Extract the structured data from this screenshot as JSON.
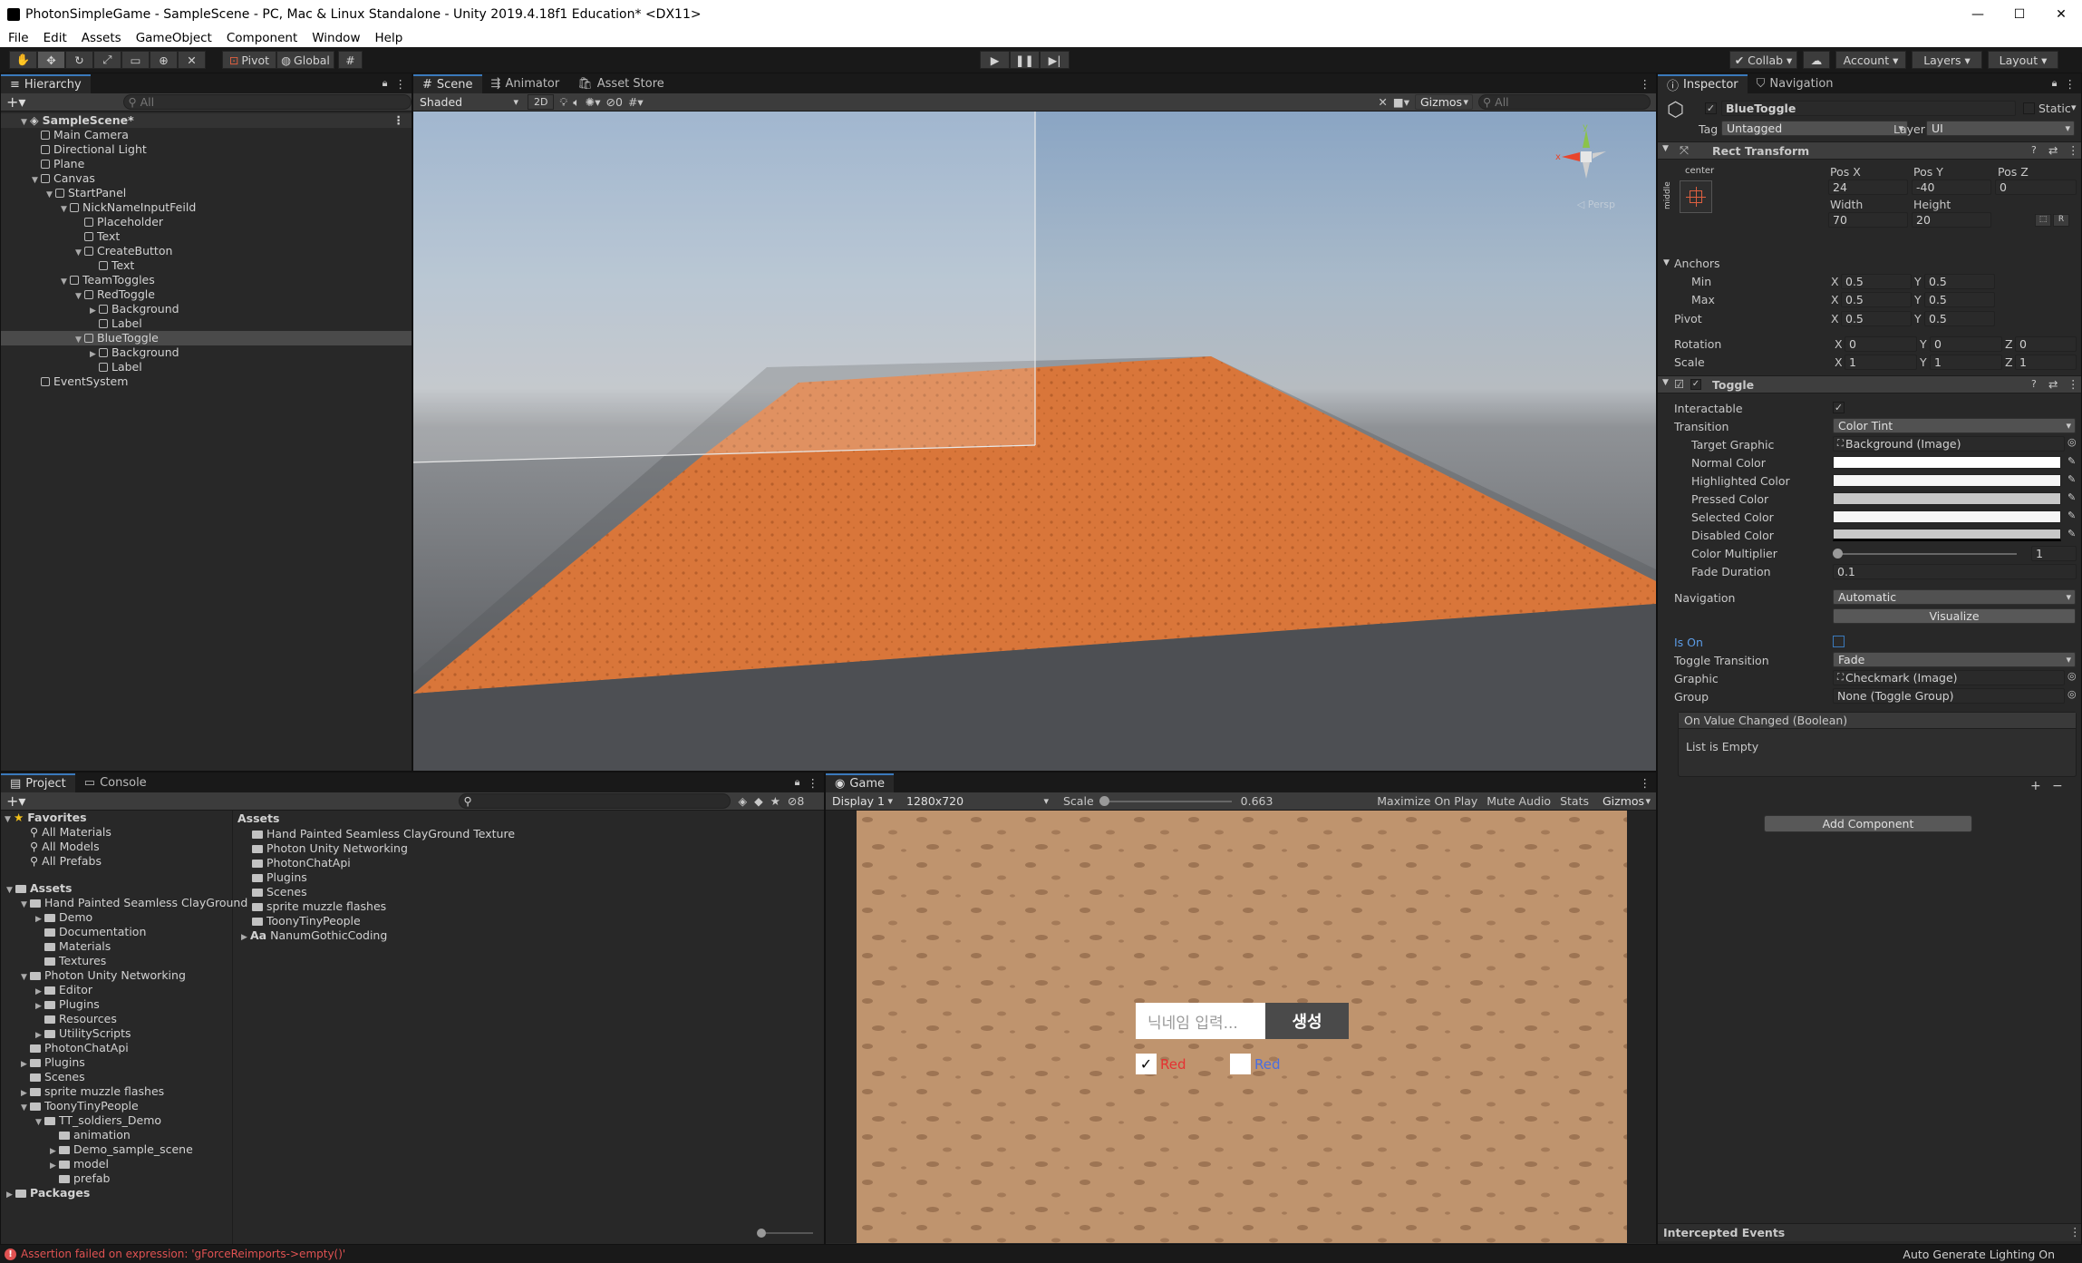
{
  "window": {
    "title": "PhotonSimpleGame - SampleScene - PC, Mac & Linux Standalone - Unity 2019.4.18f1 Education* <DX11>",
    "min": "—",
    "max": "☐",
    "close": "✕"
  },
  "menu": [
    "File",
    "Edit",
    "Assets",
    "GameObject",
    "Component",
    "Window",
    "Help"
  ],
  "toolbar": {
    "pivot": "Pivot",
    "global": "Global",
    "collab": "Collab",
    "account": "Account",
    "layers": "Layers",
    "layout": "Layout"
  },
  "hierarchy": {
    "tab": "Hierarchy",
    "search": "All",
    "scene": "SampleScene*",
    "items": [
      {
        "label": "Main Camera",
        "indent": 1,
        "arrow": ""
      },
      {
        "label": "Directional Light",
        "indent": 1,
        "arrow": ""
      },
      {
        "label": "Plane",
        "indent": 1,
        "arrow": ""
      },
      {
        "label": "Canvas",
        "indent": 1,
        "arrow": "▼"
      },
      {
        "label": "StartPanel",
        "indent": 2,
        "arrow": "▼"
      },
      {
        "label": "NickNameInputFeild",
        "indent": 3,
        "arrow": "▼"
      },
      {
        "label": "Placeholder",
        "indent": 4,
        "arrow": ""
      },
      {
        "label": "Text",
        "indent": 4,
        "arrow": ""
      },
      {
        "label": "CreateButton",
        "indent": 4,
        "arrow": "▼"
      },
      {
        "label": "Text",
        "indent": 5,
        "arrow": ""
      },
      {
        "label": "TeamToggles",
        "indent": 3,
        "arrow": "▼"
      },
      {
        "label": "RedToggle",
        "indent": 4,
        "arrow": "▼"
      },
      {
        "label": "Background",
        "indent": 5,
        "arrow": "▶"
      },
      {
        "label": "Label",
        "indent": 5,
        "arrow": ""
      },
      {
        "label": "BlueToggle",
        "indent": 4,
        "arrow": "▼"
      },
      {
        "label": "Background",
        "indent": 5,
        "arrow": "▶"
      },
      {
        "label": "Label",
        "indent": 5,
        "arrow": ""
      },
      {
        "label": "EventSystem",
        "indent": 1,
        "arrow": ""
      }
    ]
  },
  "scene": {
    "tabs": [
      "Scene",
      "Animator",
      "Asset Store"
    ],
    "shading": "Shaded",
    "mode2d": "2D",
    "gizmos": "Gizmos",
    "search": "All",
    "hidden_count": "0",
    "persp": "◁ Persp"
  },
  "project": {
    "tabs": [
      "Project",
      "Console"
    ],
    "count": "8",
    "favorites": {
      "label": "Favorites",
      "items": [
        "All Materials",
        "All Models",
        "All Prefabs"
      ]
    },
    "tree": [
      {
        "label": "Assets",
        "indent": 0,
        "arrow": "▼",
        "bold": true
      },
      {
        "label": "Hand Painted Seamless ClayGround",
        "indent": 1,
        "arrow": "▼"
      },
      {
        "label": "Demo",
        "indent": 2,
        "arrow": "▶"
      },
      {
        "label": "Documentation",
        "indent": 2,
        "arrow": ""
      },
      {
        "label": "Materials",
        "indent": 2,
        "arrow": ""
      },
      {
        "label": "Textures",
        "indent": 2,
        "arrow": ""
      },
      {
        "label": "Photon Unity Networking",
        "indent": 1,
        "arrow": "▼"
      },
      {
        "label": "Editor",
        "indent": 2,
        "arrow": "▶"
      },
      {
        "label": "Plugins",
        "indent": 2,
        "arrow": "▶"
      },
      {
        "label": "Resources",
        "indent": 2,
        "arrow": ""
      },
      {
        "label": "UtilityScripts",
        "indent": 2,
        "arrow": "▶"
      },
      {
        "label": "PhotonChatApi",
        "indent": 1,
        "arrow": ""
      },
      {
        "label": "Plugins",
        "indent": 1,
        "arrow": "▶"
      },
      {
        "label": "Scenes",
        "indent": 1,
        "arrow": ""
      },
      {
        "label": "sprite muzzle flashes",
        "indent": 1,
        "arrow": "▶"
      },
      {
        "label": "ToonyTinyPeople",
        "indent": 1,
        "arrow": "▼"
      },
      {
        "label": "TT_soldiers_Demo",
        "indent": 2,
        "arrow": "▼"
      },
      {
        "label": "animation",
        "indent": 3,
        "arrow": ""
      },
      {
        "label": "Demo_sample_scene",
        "indent": 3,
        "arrow": "▶"
      },
      {
        "label": "model",
        "indent": 3,
        "arrow": "▶"
      },
      {
        "label": "prefab",
        "indent": 3,
        "arrow": ""
      },
      {
        "label": "Packages",
        "indent": 0,
        "arrow": "▶",
        "bold": true
      }
    ],
    "assets_header": "Assets",
    "assets": [
      {
        "label": "Hand Painted Seamless ClayGround Texture",
        "font": false
      },
      {
        "label": "Photon Unity Networking",
        "font": false
      },
      {
        "label": "PhotonChatApi",
        "font": false
      },
      {
        "label": "Plugins",
        "font": false
      },
      {
        "label": "Scenes",
        "font": false
      },
      {
        "label": "sprite muzzle flashes",
        "font": false
      },
      {
        "label": "ToonyTinyPeople",
        "font": false
      },
      {
        "label": "NanumGothicCoding",
        "font": true,
        "font_glyph": "Aa"
      }
    ]
  },
  "game": {
    "tab": "Game",
    "display": "Display 1",
    "resolution": "1280x720",
    "scale_label": "Scale",
    "scale_value": "0.663",
    "buttons": [
      "Maximize On Play",
      "Mute Audio",
      "Stats",
      "Gizmos"
    ],
    "ui": {
      "placeholder": "닉네임 입력...",
      "create": "생성",
      "toggle_red": "Red",
      "toggle_blue": "Red",
      "check": "✓"
    }
  },
  "inspector": {
    "tabs": [
      "Inspector",
      "Navigation"
    ],
    "object_name": "BlueToggle",
    "static": "Static",
    "tag_label": "Tag",
    "tag": "Untagged",
    "layer_label": "Layer",
    "layer": "UI",
    "rect": {
      "title": "Rect Transform",
      "anchor_h": "center",
      "anchor_v": "middle",
      "posx_label": "Pos X",
      "posy_label": "Pos Y",
      "posz_label": "Pos Z",
      "posx": "24",
      "posy": "-40",
      "posz": "0",
      "width_label": "Width",
      "height_label": "Height",
      "width": "70",
      "height": "20",
      "r_btn": "R",
      "anchors": "Anchors",
      "min": "Min",
      "max": "Max",
      "pivot": "Pivot",
      "min_x": "0.5",
      "min_y": "0.5",
      "max_x": "0.5",
      "max_y": "0.5",
      "pivot_x": "0.5",
      "pivot_y": "0.5",
      "rotation": "Rotation",
      "scale": "Scale",
      "rot_x": "0",
      "rot_y": "0",
      "rot_z": "0",
      "scale_x": "1",
      "scale_y": "1",
      "scale_z": "1",
      "x": "X",
      "y": "Y",
      "z": "Z"
    },
    "toggle": {
      "title": "Toggle",
      "interactable": "Interactable",
      "transition": "Transition",
      "transition_value": "Color Tint",
      "target_graphic": "Target Graphic",
      "target_graphic_value": "Background (Image)",
      "normal": "Normal Color",
      "highlighted": "Highlighted Color",
      "pressed": "Pressed Color",
      "selected": "Selected Color",
      "disabled": "Disabled Color",
      "multiplier": "Color Multiplier",
      "multiplier_value": "1",
      "fade": "Fade Duration",
      "fade_value": "0.1",
      "navigation": "Navigation",
      "navigation_value": "Automatic",
      "visualize": "Visualize",
      "is_on": "Is On",
      "toggle_transition": "Toggle Transition",
      "toggle_transition_value": "Fade",
      "graphic": "Graphic",
      "graphic_value": "Checkmark (Image)",
      "group": "Group",
      "group_value": "None (Toggle Group)",
      "event_title": "On Value Changed (Boolean)",
      "event_empty": "List is Empty",
      "plus": "+",
      "minus": "−"
    },
    "add_component": "Add Component",
    "intercepted": "Intercepted Events"
  },
  "status": {
    "error": "Assertion failed on expression: 'gForceReimports->empty()'",
    "lighting": "Auto Generate Lighting On"
  },
  "colors": {
    "accent": "#3a79bb",
    "ground": "#d9763a",
    "error": "#e05252",
    "toggle_red": "#e53232",
    "toggle_blue": "#4a6ee0"
  }
}
